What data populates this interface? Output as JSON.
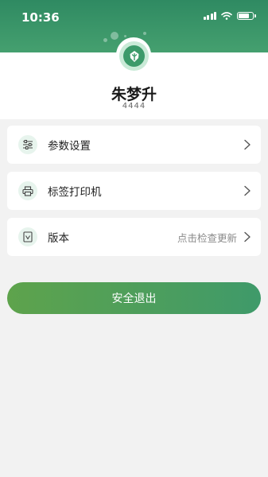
{
  "status_bar": {
    "time": "10:36"
  },
  "profile": {
    "name": "朱梦升",
    "id": "4444"
  },
  "menu": [
    {
      "label": "参数设置",
      "icon": "sliders-icon"
    },
    {
      "label": "标签打印机",
      "icon": "printer-icon"
    },
    {
      "label": "版本",
      "icon": "version-document-icon",
      "extra": "点击检查更新"
    }
  ],
  "logout": {
    "label": "安全退出"
  },
  "colors": {
    "header": "#3a9567",
    "accent": "#3c9a6a",
    "logout_gradient_start": "#5ea34c",
    "logout_gradient_end": "#3f9a6a",
    "background": "#f2f2f2"
  }
}
